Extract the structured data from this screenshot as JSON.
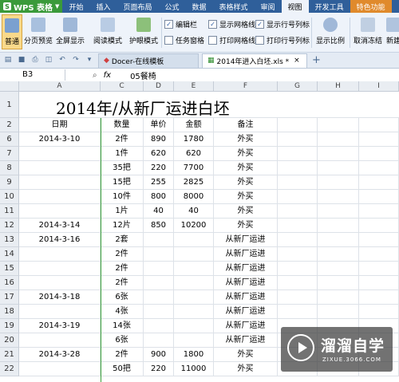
{
  "app": {
    "logo_text": "WPS 表格",
    "menu_tabs": [
      "开始",
      "插入",
      "页面布局",
      "公式",
      "数据",
      "表格样式",
      "审阅",
      "视图",
      "开发工具",
      "特色功能"
    ],
    "active_tab": "视图"
  },
  "ribbon": {
    "normal": "普通",
    "page_break_preview": "分页预览",
    "fullscreen": "全屏显示",
    "reading_mode": "阅读模式",
    "eye_protect": "护眼模式",
    "edit_bar": "编辑栏",
    "task_pane": "任务窗格",
    "show_gridlines": "显示网格线",
    "print_gridlines": "打印网格线",
    "show_headers": "显示行号列标",
    "print_headers": "打印行号列标",
    "zoom": "显示比例",
    "unfreeze": "取消冻结",
    "new_window": "新建"
  },
  "tabs": [
    {
      "label": "Docer-在线模板"
    },
    {
      "label": "2014年进入白坯.xls *"
    }
  ],
  "formula_bar": {
    "cell_ref": "B3",
    "fx": "fx",
    "content": "05餐椅"
  },
  "columns": [
    "A",
    "C",
    "D",
    "E",
    "F",
    "G",
    "H",
    "I"
  ],
  "sheet_title": "2014年/从新厂运进白坯",
  "header_row": {
    "row": "2",
    "date": "日期",
    "qty": "数量",
    "price": "单价",
    "amount": "金额",
    "note": "备注"
  },
  "rows": [
    {
      "row": "6",
      "date": "2014-3-10",
      "qty": "2件",
      "price": "890",
      "amount": "1780",
      "note": "外买"
    },
    {
      "row": "7",
      "date": "",
      "qty": "1件",
      "price": "620",
      "amount": "620",
      "note": "外买"
    },
    {
      "row": "8",
      "date": "",
      "qty": "35把",
      "price": "220",
      "amount": "7700",
      "note": "外买"
    },
    {
      "row": "9",
      "date": "",
      "qty": "15把",
      "price": "255",
      "amount": "2825",
      "note": "外买"
    },
    {
      "row": "10",
      "date": "",
      "qty": "10件",
      "price": "800",
      "amount": "8000",
      "note": "外买"
    },
    {
      "row": "11",
      "date": "",
      "qty": "1片",
      "price": "40",
      "amount": "40",
      "note": "外买"
    },
    {
      "row": "12",
      "date": "2014-3-14",
      "qty": "12片",
      "price": "850",
      "amount": "10200",
      "note": "外买"
    },
    {
      "row": "13",
      "date": "2014-3-16",
      "qty": "2套",
      "price": "",
      "amount": "",
      "note": "从新厂运进"
    },
    {
      "row": "14",
      "date": "",
      "qty": "2件",
      "price": "",
      "amount": "",
      "note": "从新厂运进"
    },
    {
      "row": "15",
      "date": "",
      "qty": "2件",
      "price": "",
      "amount": "",
      "note": "从新厂运进"
    },
    {
      "row": "16",
      "date": "",
      "qty": "2件",
      "price": "",
      "amount": "",
      "note": "从新厂运进"
    },
    {
      "row": "17",
      "date": "2014-3-18",
      "qty": "6张",
      "price": "",
      "amount": "",
      "note": "从新厂运进"
    },
    {
      "row": "18",
      "date": "",
      "qty": "4张",
      "price": "",
      "amount": "",
      "note": "从新厂运进"
    },
    {
      "row": "19",
      "date": "2014-3-19",
      "qty": "14张",
      "price": "",
      "amount": "",
      "note": "从新厂运进"
    },
    {
      "row": "20",
      "date": "",
      "qty": "6张",
      "price": "",
      "amount": "",
      "note": "从新厂运进"
    },
    {
      "row": "21",
      "date": "2014-3-28",
      "qty": "2件",
      "price": "900",
      "amount": "1800",
      "note": "外买"
    },
    {
      "row": "22",
      "date": "",
      "qty": "50把",
      "price": "220",
      "amount": "11000",
      "note": "外买"
    }
  ],
  "watermark": {
    "brand": "溜溜自学",
    "url": "ZIXUE.3066.COM"
  },
  "colors": {
    "titlebar": "#2f5f9a",
    "ribbon_bg": "#eef3fa",
    "accent_green": "#3a9a3a",
    "watermark_bg": "#3c3c3c"
  }
}
